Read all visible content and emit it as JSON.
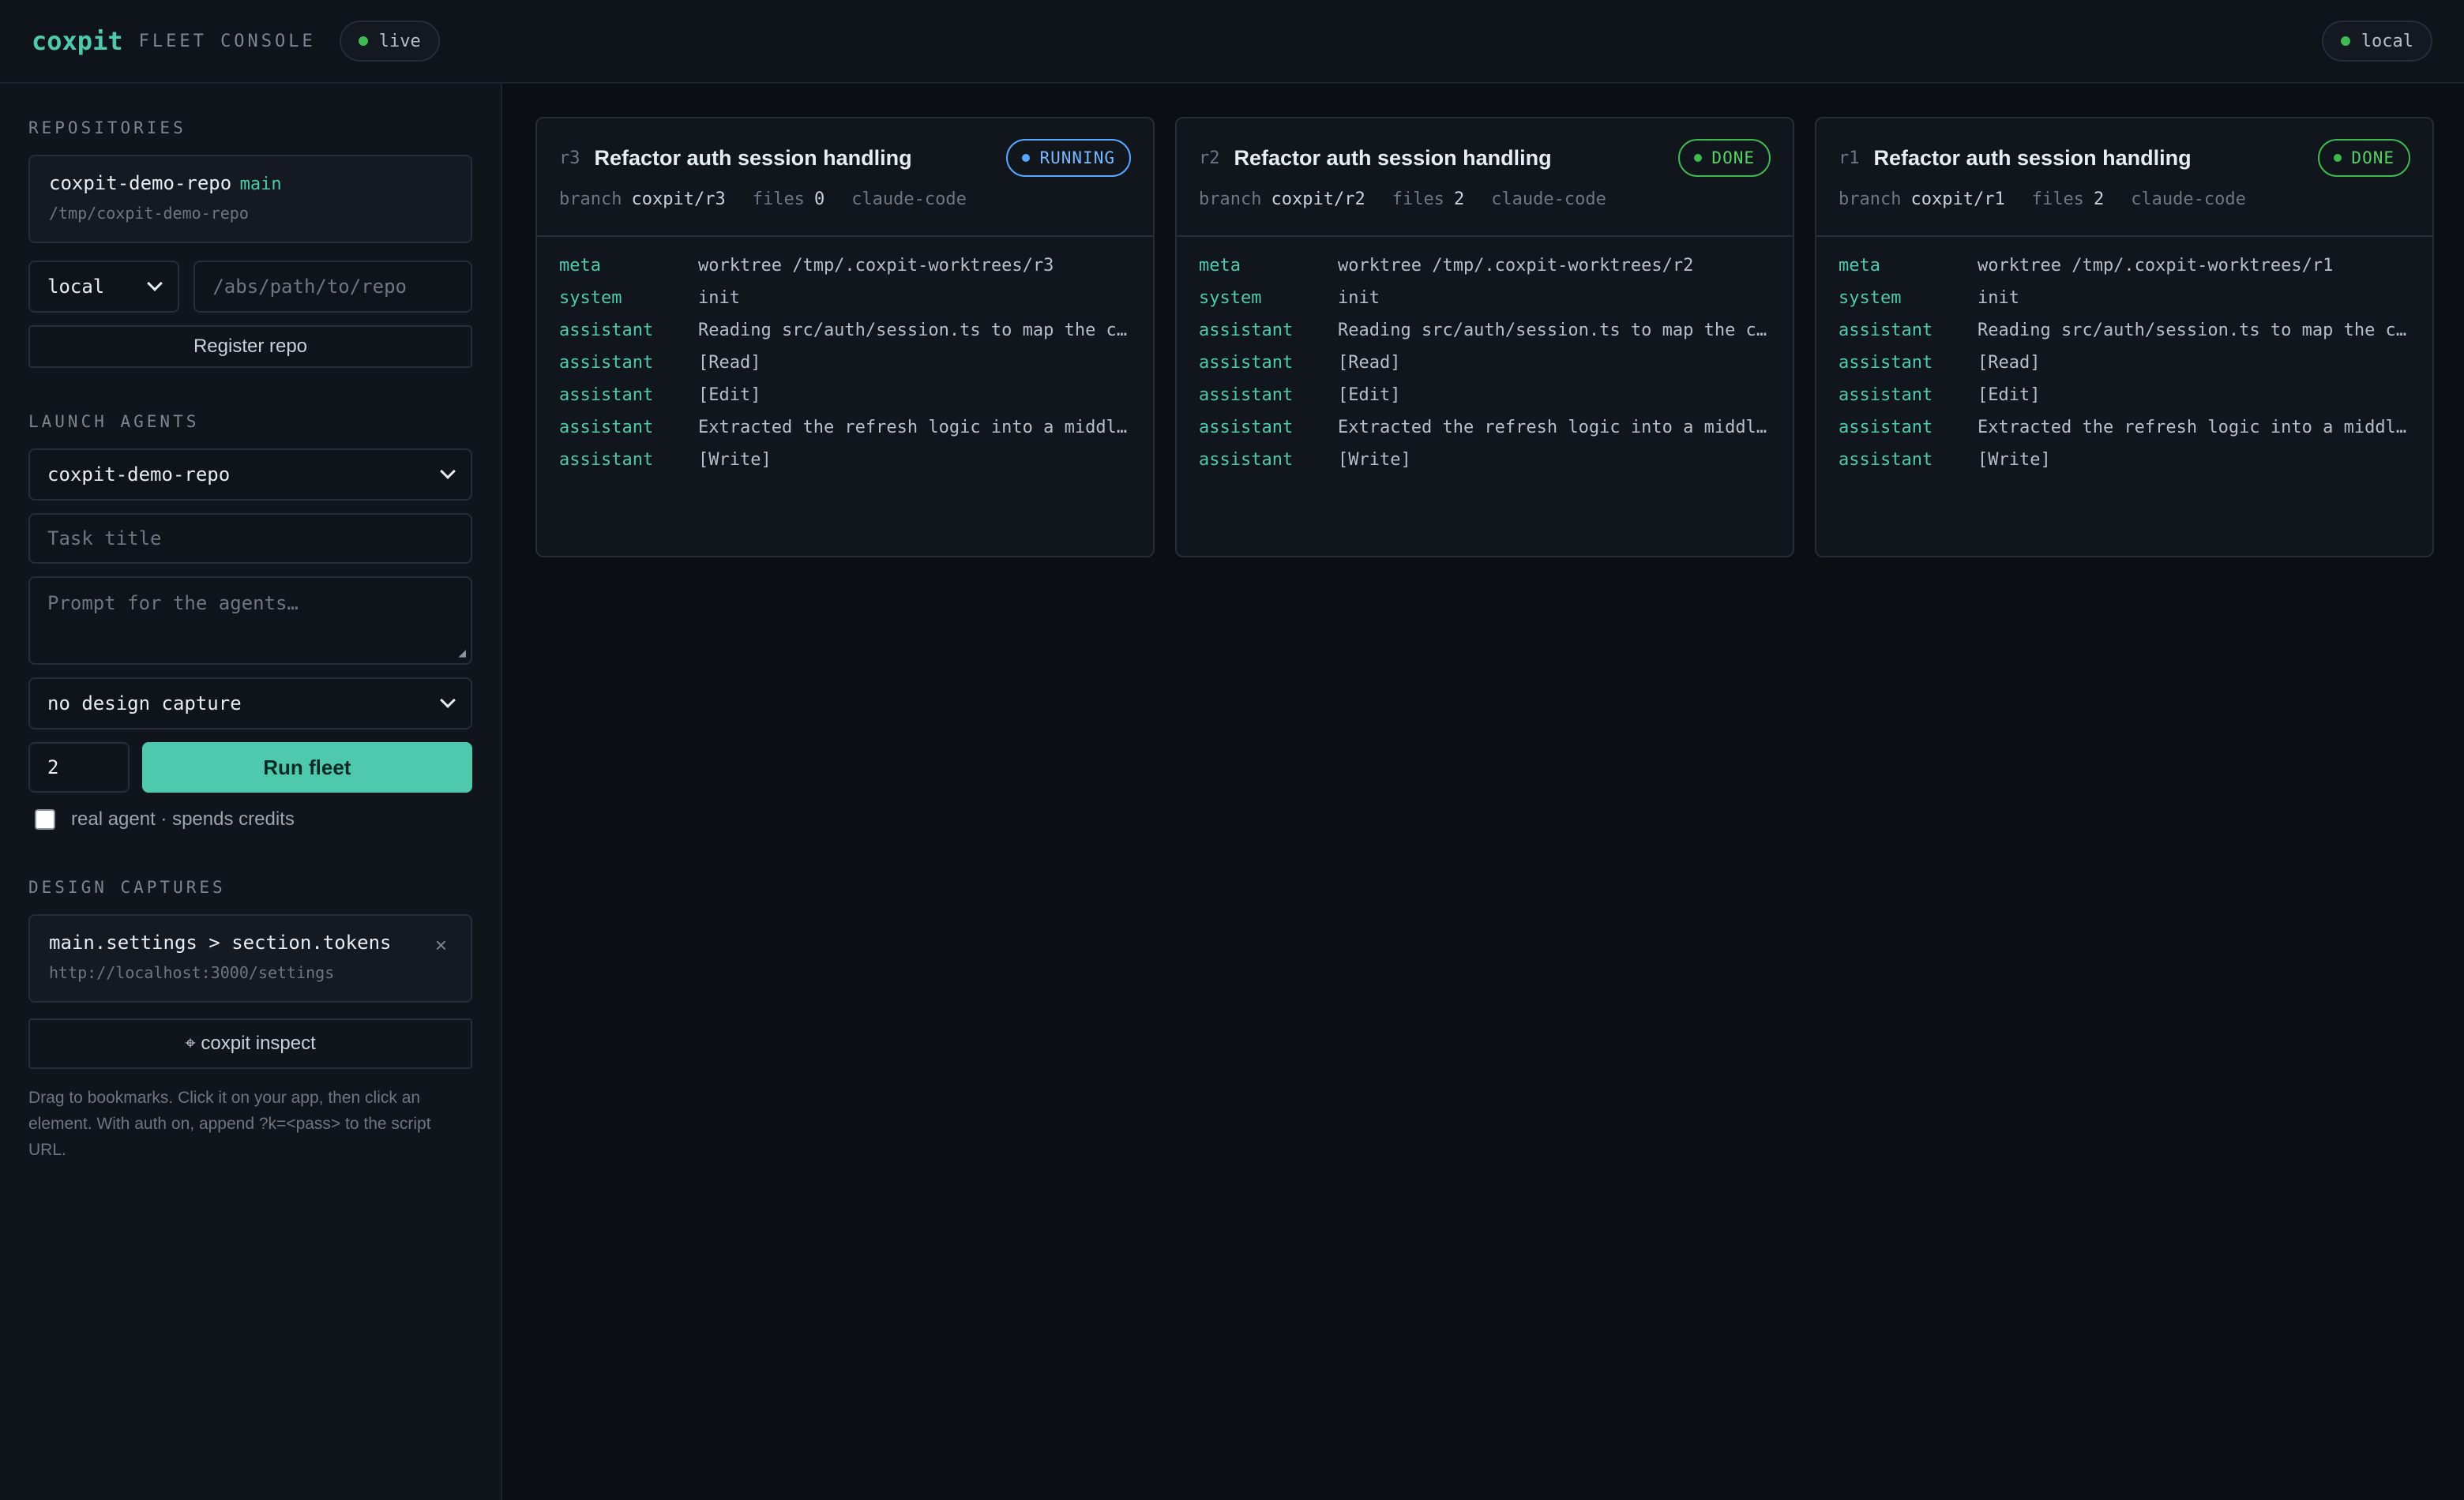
{
  "header": {
    "brand": "coxpit",
    "subtitle": "FLEET CONSOLE",
    "live_label": "live",
    "env_label": "local"
  },
  "sidebar": {
    "repositories": {
      "title": "REPOSITORIES",
      "repo": {
        "name": "coxpit-demo-repo",
        "branch": "main",
        "path": "/tmp/coxpit-demo-repo"
      },
      "location_select": "local",
      "path_placeholder": "/abs/path/to/repo",
      "register_label": "Register repo"
    },
    "launch": {
      "title": "LAUNCH AGENTS",
      "repo_select": "coxpit-demo-repo",
      "task_placeholder": "Task title",
      "prompt_placeholder": "Prompt for the agents…",
      "design_select": "no design capture",
      "count": "2",
      "run_label": "Run fleet",
      "real_agent_label": "real agent · spends credits"
    },
    "captures": {
      "title": "DESIGN CAPTURES",
      "item": {
        "selector": "main.settings > section.tokens",
        "url": "http://localhost:3000/settings",
        "close": "×"
      },
      "inspect_label": "⌖ coxpit inspect",
      "hint": "Drag to bookmarks. Click it on your app, then click an element. With auth on, append ?k=<pass> to the script URL."
    }
  },
  "labels": {
    "branch": "branch",
    "files": "files"
  },
  "runs": [
    {
      "id": "r3",
      "title": "Refactor auth session handling",
      "status": "RUNNING",
      "branch": "coxpit/r3",
      "files": "0",
      "agent": "claude-code",
      "log": [
        {
          "kind": "meta",
          "text": "worktree /tmp/.coxpit-worktrees/r3"
        },
        {
          "kind": "system",
          "text": "init"
        },
        {
          "kind": "assistant",
          "text": "Reading src/auth/session.ts to map the current flow"
        },
        {
          "kind": "assistant",
          "text": "[Read]"
        },
        {
          "kind": "assistant",
          "text": "[Edit]"
        },
        {
          "kind": "assistant",
          "text": "Extracted the refresh logic into a middleware"
        },
        {
          "kind": "assistant",
          "text": "[Write]"
        }
      ]
    },
    {
      "id": "r2",
      "title": "Refactor auth session handling",
      "status": "DONE",
      "branch": "coxpit/r2",
      "files": "2",
      "agent": "claude-code",
      "log": [
        {
          "kind": "meta",
          "text": "worktree /tmp/.coxpit-worktrees/r2"
        },
        {
          "kind": "system",
          "text": "init"
        },
        {
          "kind": "assistant",
          "text": "Reading src/auth/session.ts to map the current flow"
        },
        {
          "kind": "assistant",
          "text": "[Read]"
        },
        {
          "kind": "assistant",
          "text": "[Edit]"
        },
        {
          "kind": "assistant",
          "text": "Extracted the refresh logic into a middleware"
        },
        {
          "kind": "assistant",
          "text": "[Write]"
        }
      ]
    },
    {
      "id": "r1",
      "title": "Refactor auth session handling",
      "status": "DONE",
      "branch": "coxpit/r1",
      "files": "2",
      "agent": "claude-code",
      "log": [
        {
          "kind": "meta",
          "text": "worktree /tmp/.coxpit-worktrees/r1"
        },
        {
          "kind": "system",
          "text": "init"
        },
        {
          "kind": "assistant",
          "text": "Reading src/auth/session.ts to map the current flow"
        },
        {
          "kind": "assistant",
          "text": "[Read]"
        },
        {
          "kind": "assistant",
          "text": "[Edit]"
        },
        {
          "kind": "assistant",
          "text": "Extracted the refresh logic into a middleware"
        },
        {
          "kind": "assistant",
          "text": "[Write]"
        }
      ]
    }
  ],
  "colors": {
    "accent": "#4fc9ad",
    "running": "#58a6ff",
    "done": "#3fb950"
  }
}
